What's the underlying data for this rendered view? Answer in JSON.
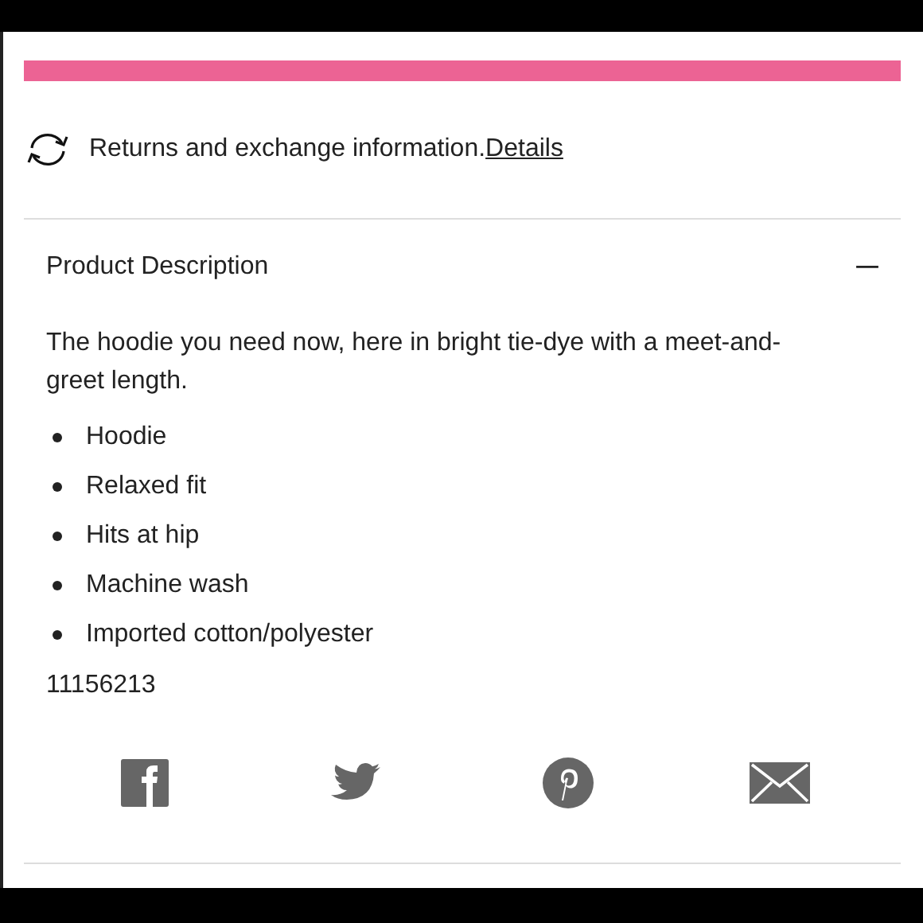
{
  "returns": {
    "text": "Returns and exchange information.",
    "link": "Details"
  },
  "accordion": {
    "title": "Product Description",
    "expanded": true,
    "description": "The hoodie you need now, here in bright tie-dye with a meet-and-greet length.",
    "bullets": [
      "Hoodie",
      "Relaxed fit",
      "Hits at hip",
      "Machine wash",
      "Imported cotton/polyester"
    ],
    "item_number": "11156213"
  },
  "share": [
    {
      "kind": "square"
    },
    {
      "kind": "bird"
    },
    {
      "kind": "pin"
    },
    {
      "kind": "mail"
    }
  ]
}
